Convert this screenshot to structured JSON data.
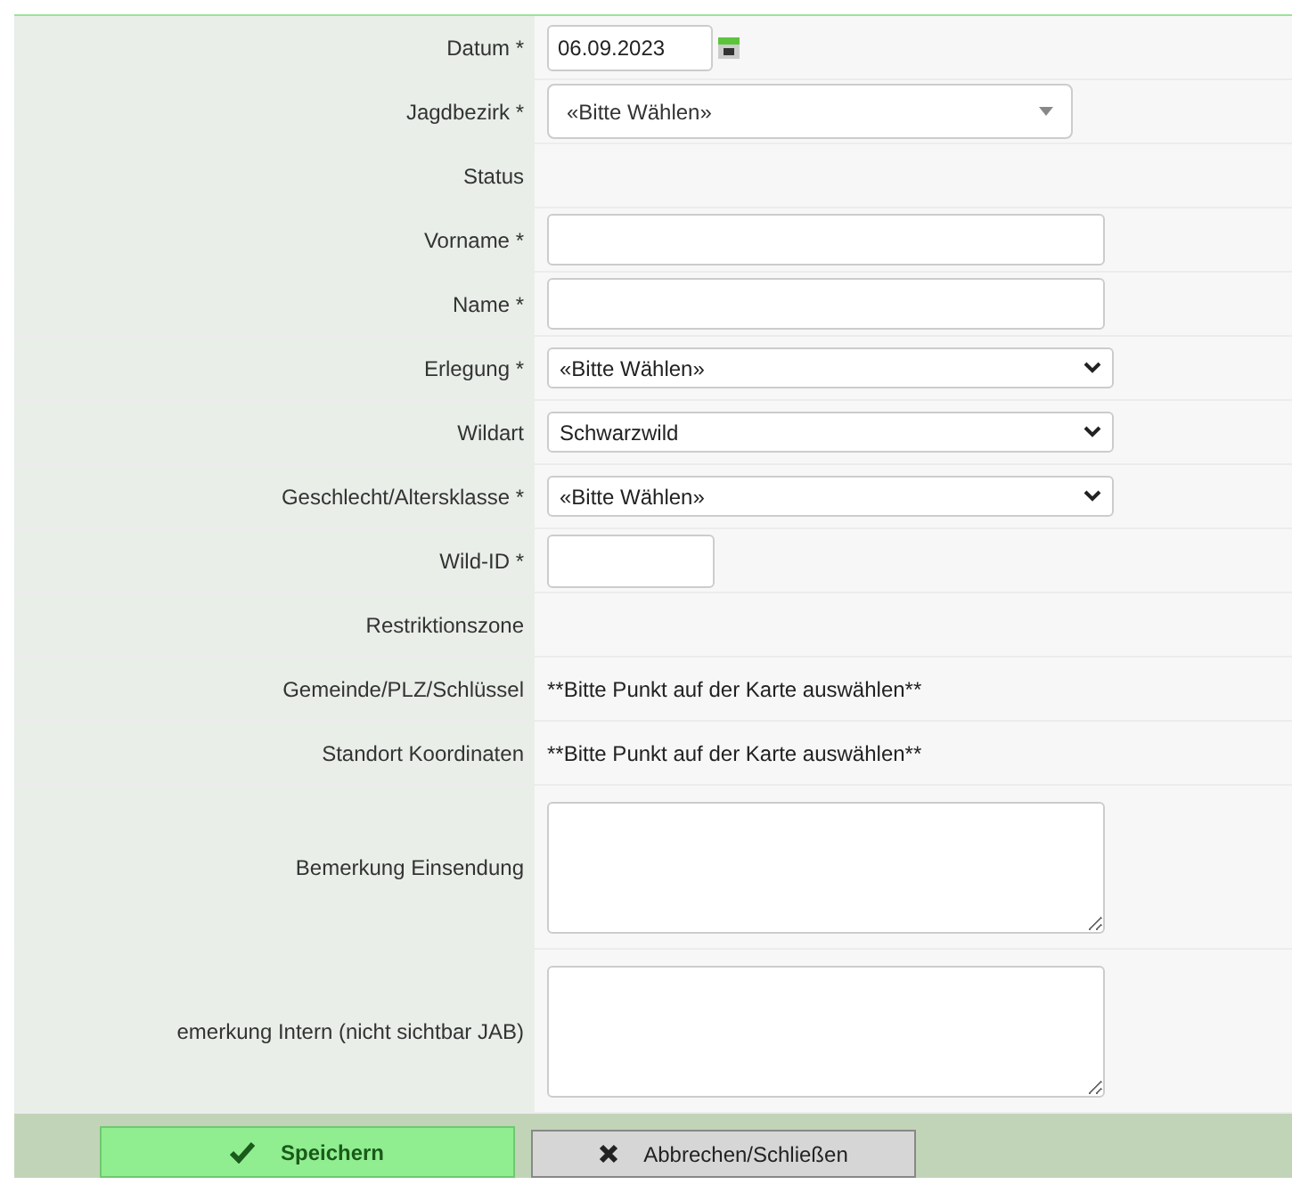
{
  "rows": [
    {
      "label": "Datum *",
      "kind": "date",
      "value": "06.09.2023"
    },
    {
      "label": "Jagdbezirk *",
      "kind": "combo",
      "value": "«Bitte Wählen»"
    },
    {
      "label": "Status",
      "kind": "empty"
    },
    {
      "label": "Vorname *",
      "kind": "input"
    },
    {
      "label": "Name *",
      "kind": "input"
    },
    {
      "label": "Erlegung *",
      "kind": "select",
      "value": "«Bitte Wählen»"
    },
    {
      "label": "Wildart",
      "kind": "select",
      "value": "Schwarzwild"
    },
    {
      "label": "Geschlecht/Altersklasse *",
      "kind": "select",
      "value": "«Bitte Wählen»"
    },
    {
      "label": "Wild-ID *",
      "kind": "short"
    },
    {
      "label": "Restriktionszone",
      "kind": "empty"
    },
    {
      "label": "Gemeinde/PLZ/Schlüssel",
      "kind": "text",
      "value": "**Bitte Punkt auf der Karte auswählen**"
    },
    {
      "label": "Standort Koordinaten",
      "kind": "text",
      "value": "**Bitte Punkt auf der Karte auswählen**"
    },
    {
      "label": "Bemerkung Einsendung",
      "kind": "textarea"
    },
    {
      "label": "emerkung Intern (nicht sichtbar JAB)",
      "kind": "textarea"
    }
  ],
  "buttons": [
    {
      "label": "Speichern",
      "kind": "save"
    },
    {
      "label": "Abbrechen/Schließen",
      "kind": "cancel"
    }
  ]
}
